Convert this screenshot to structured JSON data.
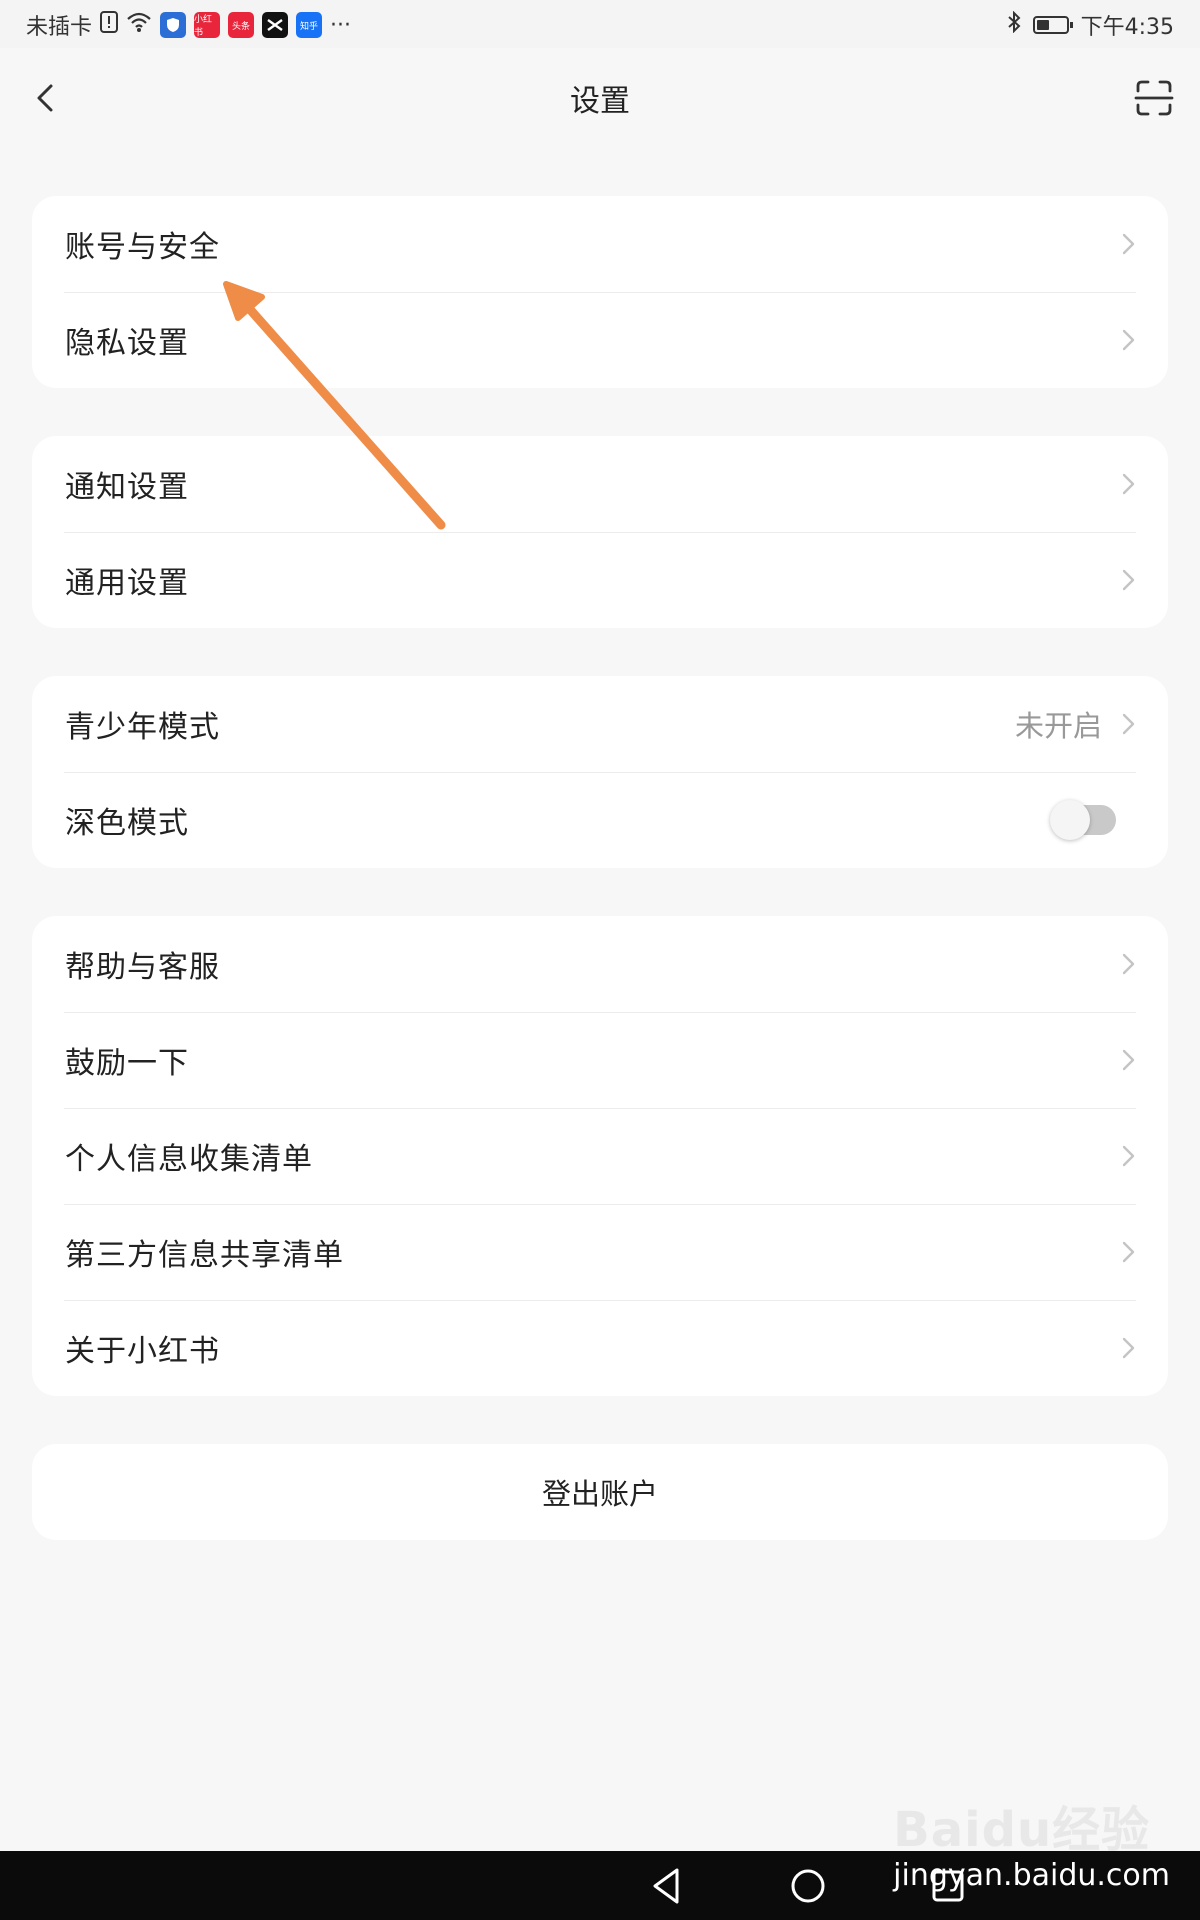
{
  "status_bar": {
    "carrier": "未插卡",
    "apps": [
      {
        "name": "小红书",
        "color": "#e8253b"
      },
      {
        "name": "头条",
        "color": "#e8253b"
      },
      {
        "name": "知乎",
        "color": "#1772f6"
      }
    ],
    "more": "···",
    "time": "下午4:35"
  },
  "header": {
    "title": "设置"
  },
  "groups": {
    "account": [
      {
        "label": "账号与安全"
      },
      {
        "label": "隐私设置"
      }
    ],
    "general": [
      {
        "label": "通知设置"
      },
      {
        "label": "通用设置"
      }
    ],
    "modes": {
      "youth_label": "青少年模式",
      "youth_value": "未开启",
      "dark_label": "深色模式",
      "dark_enabled": false
    },
    "about": [
      {
        "label": "帮助与客服"
      },
      {
        "label": "鼓励一下"
      },
      {
        "label": "个人信息收集清单"
      },
      {
        "label": "第三方信息共享清单"
      },
      {
        "label": "关于小红书"
      }
    ]
  },
  "logout_label": "登出账户",
  "watermark": {
    "logo": "Baidu经验",
    "url": "jingyan.baidu.com"
  },
  "colors": {
    "annotation_arrow": "#ef8c48",
    "page_bg": "#f7f7f7"
  }
}
